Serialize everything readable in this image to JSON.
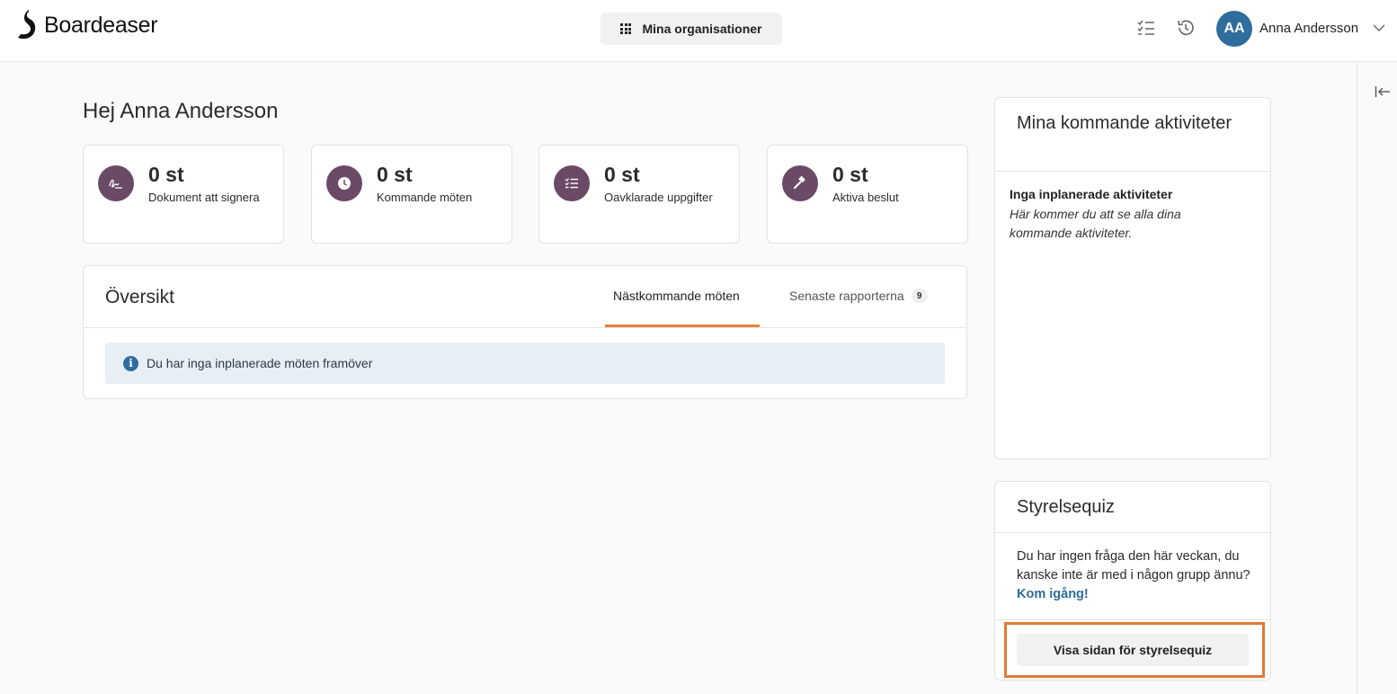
{
  "header": {
    "brand": "Boardeaser",
    "org_button": "Mina organisationer",
    "user": {
      "initials": "AA",
      "name": "Anna Andersson"
    },
    "icons": [
      "checklist-icon",
      "history-icon",
      "chevron-down-icon"
    ]
  },
  "greeting": "Hej Anna Andersson",
  "stats": [
    {
      "value": "0 st",
      "label": "Dokument att signera",
      "icon": "signature-icon"
    },
    {
      "value": "0 st",
      "label": "Kommande möten",
      "icon": "clock-icon"
    },
    {
      "value": "0 st",
      "label": "Oavklarade uppgifter",
      "icon": "task-list-icon"
    },
    {
      "value": "0 st",
      "label": "Aktiva beslut",
      "icon": "gavel-icon"
    }
  ],
  "overview": {
    "title": "Översikt",
    "tabs": [
      {
        "label": "Nästkommande möten",
        "active": true
      },
      {
        "label": "Senaste rapporterna",
        "count": "9"
      }
    ],
    "alert": "Du har inga inplanerade möten framöver"
  },
  "activities": {
    "title": "Mina kommande aktiviteter",
    "empty_title": "Inga inplanerade aktiviteter",
    "empty_text": "Här kommer du att se alla dina kommande aktiviteter."
  },
  "quiz": {
    "title": "Styrelsequiz",
    "text": "Du har ingen fråga den här veckan, du kanske inte är med i någon grupp ännu?",
    "link": "Kom igång!",
    "button": "Visa sidan för styrelsequiz"
  },
  "colors": {
    "accent": "#e2823b",
    "brand_purple": "#6b4a66",
    "primary_blue": "#2e6d9c"
  }
}
